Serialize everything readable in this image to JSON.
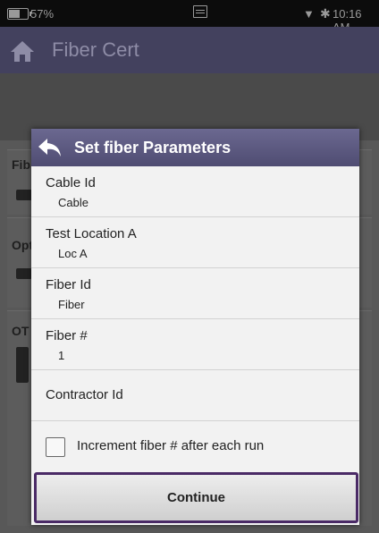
{
  "status_bar": {
    "battery_pct": "57%",
    "time": "10:16 AM",
    "icons": [
      "battery-icon",
      "screen-icon",
      "wifi-icon",
      "bluetooth-icon"
    ]
  },
  "app_bar": {
    "title": "Fiber Cert",
    "home_icon": "home-icon"
  },
  "background_sections": [
    {
      "label": "Fib"
    },
    {
      "label": "Opt"
    },
    {
      "label": "OT"
    }
  ],
  "dialog": {
    "title": "Set fiber Parameters",
    "back_icon": "back-arrow-icon",
    "fields": [
      {
        "label": "Cable Id",
        "value": "Cable"
      },
      {
        "label": "Test Location A",
        "value": "Loc A"
      },
      {
        "label": "Fiber Id",
        "value": "Fiber"
      },
      {
        "label": "Fiber #",
        "value": "1"
      },
      {
        "label": "Contractor Id",
        "value": ""
      }
    ],
    "increment_checkbox": {
      "label": "Increment fiber # after each run",
      "checked": false
    },
    "continue_label": "Continue"
  },
  "colors": {
    "app_bar": "#43415e",
    "dialog_header": "#5d5a80",
    "continue_border": "#4a2a66"
  }
}
